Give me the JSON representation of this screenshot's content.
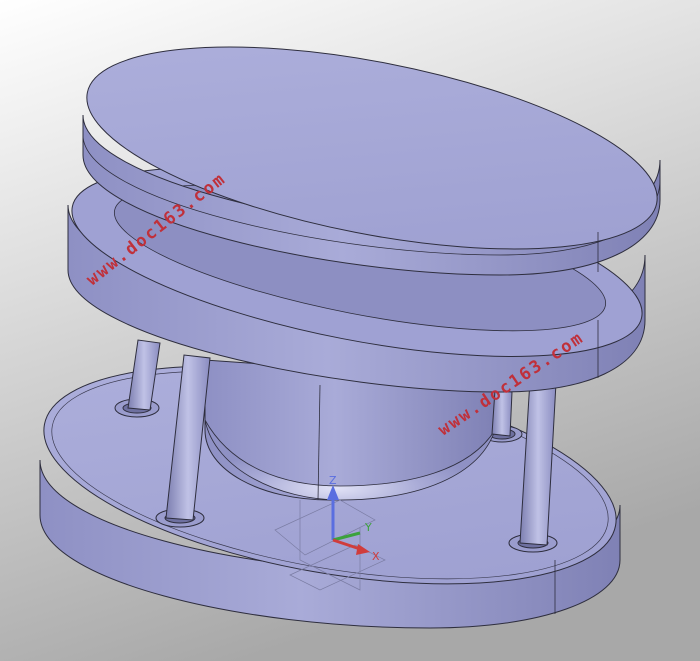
{
  "viewport": {
    "background_top": "#ffffff",
    "background_bottom": "#a9a9a9",
    "model_color": "#a3a5d2",
    "edge_color": "#2e2e3e"
  },
  "watermarks": [
    {
      "text": "www.doc163.com",
      "color": "#c0303a"
    },
    {
      "text": "www.doc163.com",
      "color": "#c0303a"
    }
  ],
  "triad": {
    "z_label": "Z",
    "y_label": "Y",
    "x_label": "X",
    "z_color": "#5a6ee0",
    "y_color": "#3ca23c",
    "x_color": "#d03c3c"
  }
}
